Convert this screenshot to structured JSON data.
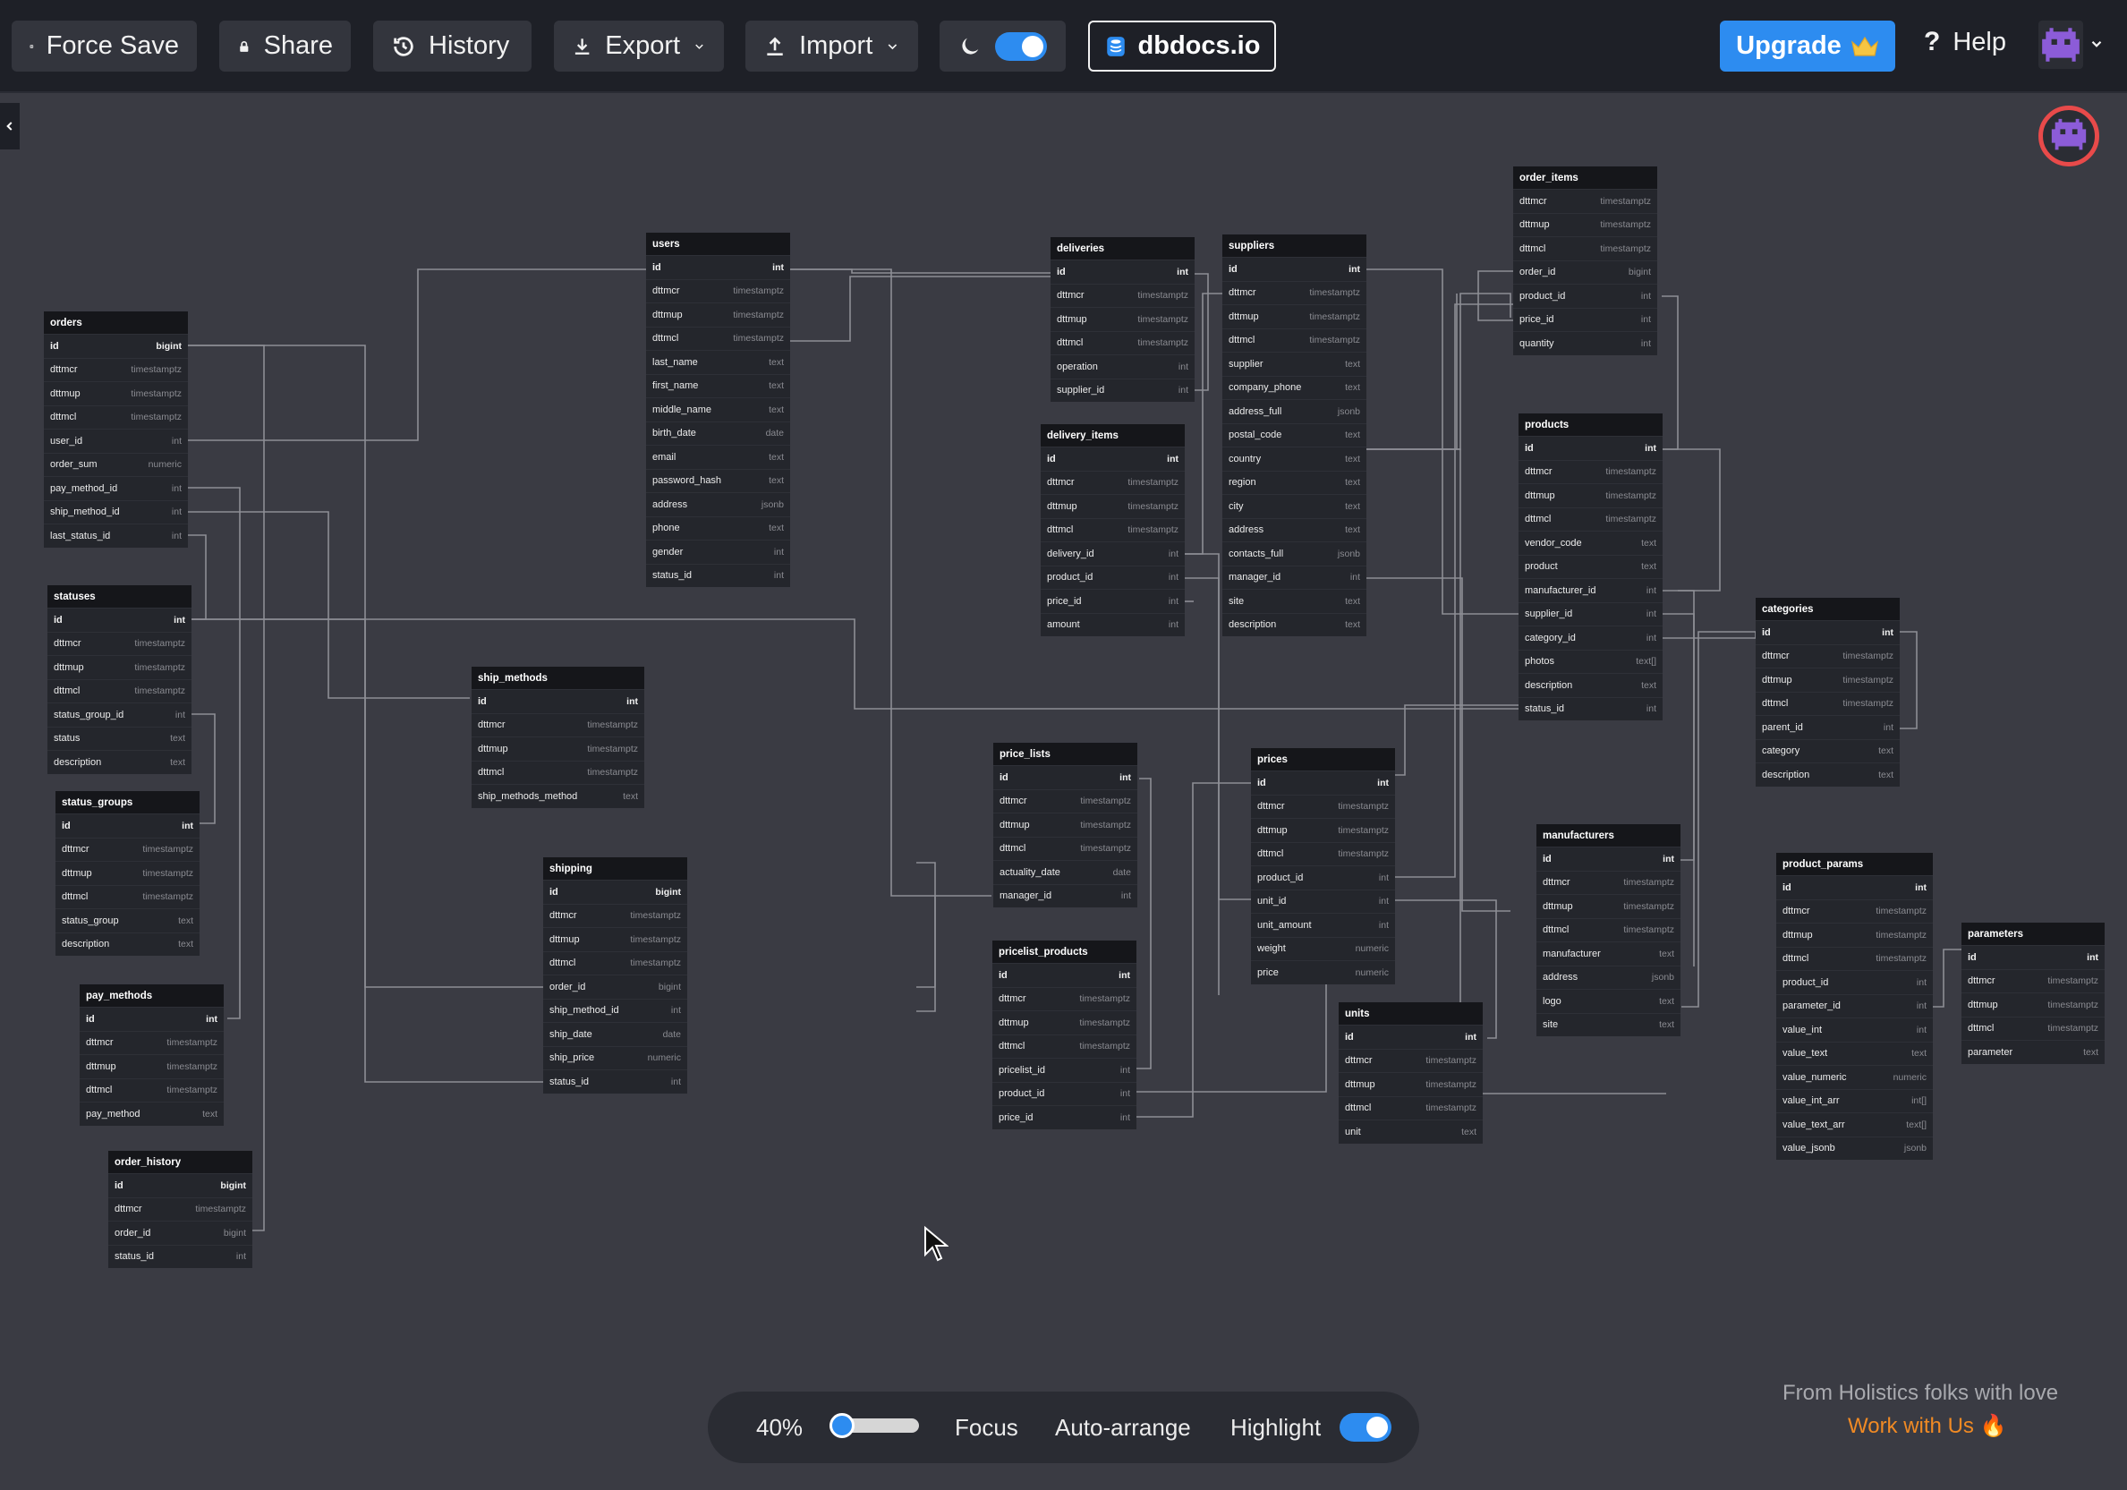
{
  "toolbar": {
    "force_save": "Force Save",
    "share": "Share",
    "history": "History",
    "export": "Export",
    "import": "Import",
    "dark_mode_on": true,
    "dbdocs": "dbdocs.io",
    "upgrade": "Upgrade",
    "help": "Help"
  },
  "bottom": {
    "zoom": "40%",
    "zoom_level": 0.4,
    "focus": "Focus",
    "auto_arrange": "Auto-arrange",
    "highlight": "Highlight",
    "highlight_on": true
  },
  "footer": {
    "credit": "From Holistics folks with love",
    "work_with_us": "Work with Us 🔥"
  },
  "colors": {
    "accent": "#2d8cf0",
    "canvas": "#3a3b43",
    "toolbar": "#1e2027",
    "table_header": "#15161a",
    "orange": "#f08a24"
  },
  "tables": {
    "orders": {
      "name": "orders",
      "cols": [
        [
          "id",
          "bigint"
        ],
        [
          "dttmcr",
          "timestamptz"
        ],
        [
          "dttmup",
          "timestamptz"
        ],
        [
          "dttmcl",
          "timestamptz"
        ],
        [
          "user_id",
          "int"
        ],
        [
          "order_sum",
          "numeric"
        ],
        [
          "pay_method_id",
          "int"
        ],
        [
          "ship_method_id",
          "int"
        ],
        [
          "last_status_id",
          "int"
        ]
      ]
    },
    "statuses": {
      "name": "statuses",
      "cols": [
        [
          "id",
          "int"
        ],
        [
          "dttmcr",
          "timestamptz"
        ],
        [
          "dttmup",
          "timestamptz"
        ],
        [
          "dttmcl",
          "timestamptz"
        ],
        [
          "status_group_id",
          "int"
        ],
        [
          "status",
          "text"
        ],
        [
          "description",
          "text"
        ]
      ]
    },
    "status_groups": {
      "name": "status_groups",
      "cols": [
        [
          "id",
          "int"
        ],
        [
          "dttmcr",
          "timestamptz"
        ],
        [
          "dttmup",
          "timestamptz"
        ],
        [
          "dttmcl",
          "timestamptz"
        ],
        [
          "status_group",
          "text"
        ],
        [
          "description",
          "text"
        ]
      ]
    },
    "pay_methods": {
      "name": "pay_methods",
      "cols": [
        [
          "id",
          "int"
        ],
        [
          "dttmcr",
          "timestamptz"
        ],
        [
          "dttmup",
          "timestamptz"
        ],
        [
          "dttmcl",
          "timestamptz"
        ],
        [
          "pay_method",
          "text"
        ]
      ]
    },
    "order_history": {
      "name": "order_history",
      "cols": [
        [
          "id",
          "bigint"
        ],
        [
          "dttmcr",
          "timestamptz"
        ],
        [
          "order_id",
          "bigint"
        ],
        [
          "status_id",
          "int"
        ]
      ]
    },
    "users": {
      "name": "users",
      "cols": [
        [
          "id",
          "int"
        ],
        [
          "dttmcr",
          "timestamptz"
        ],
        [
          "dttmup",
          "timestamptz"
        ],
        [
          "dttmcl",
          "timestamptz"
        ],
        [
          "last_name",
          "text"
        ],
        [
          "first_name",
          "text"
        ],
        [
          "middle_name",
          "text"
        ],
        [
          "birth_date",
          "date"
        ],
        [
          "email",
          "text"
        ],
        [
          "password_hash",
          "text"
        ],
        [
          "address",
          "jsonb"
        ],
        [
          "phone",
          "text"
        ],
        [
          "gender",
          "int"
        ],
        [
          "status_id",
          "int"
        ]
      ]
    },
    "ship_methods": {
      "name": "ship_methods",
      "cols": [
        [
          "id",
          "int"
        ],
        [
          "dttmcr",
          "timestamptz"
        ],
        [
          "dttmup",
          "timestamptz"
        ],
        [
          "dttmcl",
          "timestamptz"
        ],
        [
          "ship_methods_method",
          "text"
        ]
      ]
    },
    "shipping": {
      "name": "shipping",
      "cols": [
        [
          "id",
          "bigint"
        ],
        [
          "dttmcr",
          "timestamptz"
        ],
        [
          "dttmup",
          "timestamptz"
        ],
        [
          "dttmcl",
          "timestamptz"
        ],
        [
          "order_id",
          "bigint"
        ],
        [
          "ship_method_id",
          "int"
        ],
        [
          "ship_date",
          "date"
        ],
        [
          "ship_price",
          "numeric"
        ],
        [
          "status_id",
          "int"
        ]
      ]
    },
    "deliveries": {
      "name": "deliveries",
      "cols": [
        [
          "id",
          "int"
        ],
        [
          "dttmcr",
          "timestamptz"
        ],
        [
          "dttmup",
          "timestamptz"
        ],
        [
          "dttmcl",
          "timestamptz"
        ],
        [
          "operation",
          "int"
        ],
        [
          "supplier_id",
          "int"
        ]
      ]
    },
    "delivery_items": {
      "name": "delivery_items",
      "cols": [
        [
          "id",
          "int"
        ],
        [
          "dttmcr",
          "timestamptz"
        ],
        [
          "dttmup",
          "timestamptz"
        ],
        [
          "dttmcl",
          "timestamptz"
        ],
        [
          "delivery_id",
          "int"
        ],
        [
          "product_id",
          "int"
        ],
        [
          "price_id",
          "int"
        ],
        [
          "amount",
          "int"
        ]
      ]
    },
    "suppliers": {
      "name": "suppliers",
      "cols": [
        [
          "id",
          "int"
        ],
        [
          "dttmcr",
          "timestamptz"
        ],
        [
          "dttmup",
          "timestamptz"
        ],
        [
          "dttmcl",
          "timestamptz"
        ],
        [
          "supplier",
          "text"
        ],
        [
          "company_phone",
          "text"
        ],
        [
          "address_full",
          "jsonb"
        ],
        [
          "postal_code",
          "text"
        ],
        [
          "country",
          "text"
        ],
        [
          "region",
          "text"
        ],
        [
          "city",
          "text"
        ],
        [
          "address",
          "text"
        ],
        [
          "contacts_full",
          "jsonb"
        ],
        [
          "manager_id",
          "int"
        ],
        [
          "site",
          "text"
        ],
        [
          "description",
          "text"
        ]
      ]
    },
    "price_lists": {
      "name": "price_lists",
      "cols": [
        [
          "id",
          "int"
        ],
        [
          "dttmcr",
          "timestamptz"
        ],
        [
          "dttmup",
          "timestamptz"
        ],
        [
          "dttmcl",
          "timestamptz"
        ],
        [
          "actuality_date",
          "date"
        ],
        [
          "manager_id",
          "int"
        ]
      ]
    },
    "pricelist_products": {
      "name": "pricelist_products",
      "cols": [
        [
          "id",
          "int"
        ],
        [
          "dttmcr",
          "timestamptz"
        ],
        [
          "dttmup",
          "timestamptz"
        ],
        [
          "dttmcl",
          "timestamptz"
        ],
        [
          "pricelist_id",
          "int"
        ],
        [
          "product_id",
          "int"
        ],
        [
          "price_id",
          "int"
        ]
      ]
    },
    "prices": {
      "name": "prices",
      "cols": [
        [
          "id",
          "int"
        ],
        [
          "dttmcr",
          "timestamptz"
        ],
        [
          "dttmup",
          "timestamptz"
        ],
        [
          "dttmcl",
          "timestamptz"
        ],
        [
          "product_id",
          "int"
        ],
        [
          "unit_id",
          "int"
        ],
        [
          "unit_amount",
          "int"
        ],
        [
          "weight",
          "numeric"
        ],
        [
          "price",
          "numeric"
        ]
      ]
    },
    "units": {
      "name": "units",
      "cols": [
        [
          "id",
          "int"
        ],
        [
          "dttmcr",
          "timestamptz"
        ],
        [
          "dttmup",
          "timestamptz"
        ],
        [
          "dttmcl",
          "timestamptz"
        ],
        [
          "unit",
          "text"
        ]
      ]
    },
    "order_items": {
      "name": "order_items",
      "cols": [
        [
          "dttmcr",
          "timestamptz"
        ],
        [
          "dttmup",
          "timestamptz"
        ],
        [
          "dttmcl",
          "timestamptz"
        ],
        [
          "order_id",
          "bigint"
        ],
        [
          "product_id",
          "int"
        ],
        [
          "price_id",
          "int"
        ],
        [
          "quantity",
          "int"
        ]
      ]
    },
    "products": {
      "name": "products",
      "cols": [
        [
          "id",
          "int"
        ],
        [
          "dttmcr",
          "timestamptz"
        ],
        [
          "dttmup",
          "timestamptz"
        ],
        [
          "dttmcl",
          "timestamptz"
        ],
        [
          "vendor_code",
          "text"
        ],
        [
          "product",
          "text"
        ],
        [
          "manufacturer_id",
          "int"
        ],
        [
          "supplier_id",
          "int"
        ],
        [
          "category_id",
          "int"
        ],
        [
          "photos",
          "text[]"
        ],
        [
          "description",
          "text"
        ],
        [
          "status_id",
          "int"
        ]
      ]
    },
    "manufacturers": {
      "name": "manufacturers",
      "cols": [
        [
          "id",
          "int"
        ],
        [
          "dttmcr",
          "timestamptz"
        ],
        [
          "dttmup",
          "timestamptz"
        ],
        [
          "dttmcl",
          "timestamptz"
        ],
        [
          "manufacturer",
          "text"
        ],
        [
          "address",
          "jsonb"
        ],
        [
          "logo",
          "text"
        ],
        [
          "site",
          "text"
        ]
      ]
    },
    "categories": {
      "name": "categories",
      "cols": [
        [
          "id",
          "int"
        ],
        [
          "dttmcr",
          "timestamptz"
        ],
        [
          "dttmup",
          "timestamptz"
        ],
        [
          "dttmcl",
          "timestamptz"
        ],
        [
          "parent_id",
          "int"
        ],
        [
          "category",
          "text"
        ],
        [
          "description",
          "text"
        ]
      ]
    },
    "product_params": {
      "name": "product_params",
      "cols": [
        [
          "id",
          "int"
        ],
        [
          "dttmcr",
          "timestamptz"
        ],
        [
          "dttmup",
          "timestamptz"
        ],
        [
          "dttmcl",
          "timestamptz"
        ],
        [
          "product_id",
          "int"
        ],
        [
          "parameter_id",
          "int"
        ],
        [
          "value_int",
          "int"
        ],
        [
          "value_text",
          "text"
        ],
        [
          "value_numeric",
          "numeric"
        ],
        [
          "value_int_arr",
          "int[]"
        ],
        [
          "value_text_arr",
          "text[]"
        ],
        [
          "value_jsonb",
          "jsonb"
        ]
      ]
    },
    "parameters": {
      "name": "parameters",
      "cols": [
        [
          "id",
          "int"
        ],
        [
          "dttmcr",
          "timestamptz"
        ],
        [
          "dttmup",
          "timestamptz"
        ],
        [
          "dttmcl",
          "timestamptz"
        ],
        [
          "parameter",
          "text"
        ]
      ]
    }
  }
}
